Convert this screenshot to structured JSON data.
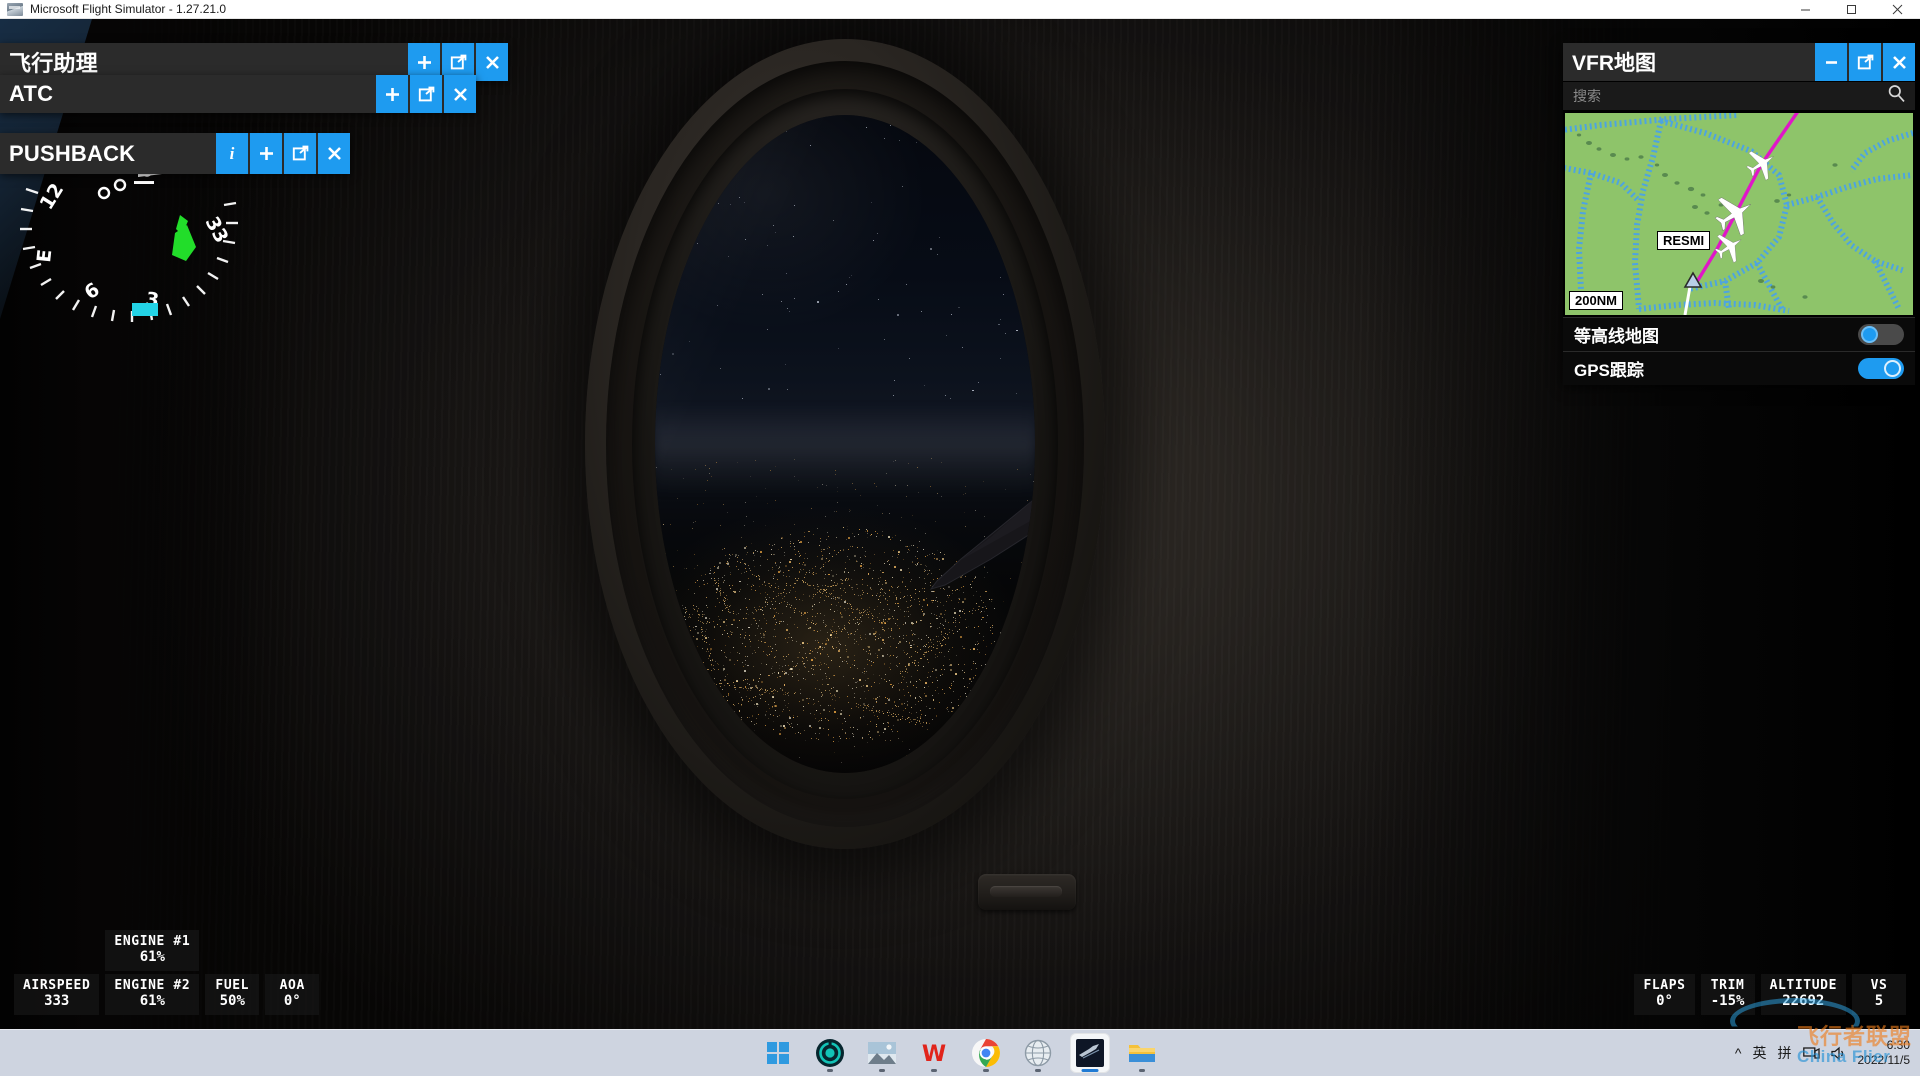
{
  "window": {
    "title": "Microsoft Flight Simulator - 1.27.21.0",
    "app_icon": "msfs-app-icon",
    "controls": {
      "minimize": "minimize-icon",
      "maximize": "maximize-icon",
      "close": "close-icon"
    }
  },
  "panels": [
    {
      "id": "assistant",
      "title": "飞行助理",
      "buttons": [
        {
          "name": "add-button",
          "glyph": "plus"
        },
        {
          "name": "popout-button",
          "glyph": "popout"
        },
        {
          "name": "close-button",
          "glyph": "close"
        }
      ]
    },
    {
      "id": "atc",
      "title": "ATC",
      "buttons": [
        {
          "name": "add-button",
          "glyph": "plus"
        },
        {
          "name": "popout-button",
          "glyph": "popout"
        },
        {
          "name": "close-button",
          "glyph": "close"
        }
      ]
    },
    {
      "id": "pushback",
      "title": "PUSHBACK",
      "buttons": [
        {
          "name": "info-button",
          "glyph": "info"
        },
        {
          "name": "add-button",
          "glyph": "plus"
        },
        {
          "name": "popout-button",
          "glyph": "popout"
        },
        {
          "name": "close-button",
          "glyph": "close"
        }
      ]
    }
  ],
  "vfr_map": {
    "title": "VFR地图",
    "window_buttons": {
      "minimize": "minimize-icon",
      "popout": "popout-icon",
      "close": "close-icon"
    },
    "search": {
      "placeholder": "搜索",
      "value": "",
      "icon": "search-icon"
    },
    "map": {
      "scale_label": "200NM",
      "waypoint_label": "RESMI",
      "terrain_color": "#8ec46a",
      "airspace_color": "#4aa3e8",
      "route_color": "#e016c8",
      "aircraft_count": 3
    },
    "options": [
      {
        "label": "等高线地图",
        "name": "contour-map-toggle",
        "state": "off"
      },
      {
        "label": "GPS跟踪",
        "name": "gps-tracking-toggle",
        "state": "on"
      }
    ]
  },
  "hud": {
    "left": [
      {
        "label": "AIRSPEED",
        "value": "333",
        "name": "airspeed-readout"
      },
      {
        "label": "ENGINE #1",
        "value": "61%",
        "name": "engine1-readout"
      },
      {
        "label": "ENGINE #2",
        "value": "61%",
        "name": "engine2-readout"
      },
      {
        "label": "FUEL",
        "value": "50%",
        "name": "fuel-readout"
      },
      {
        "label": "AOA",
        "value": "0°",
        "name": "aoa-readout"
      }
    ],
    "right": [
      {
        "label": "FLAPS",
        "value": "0°",
        "name": "flaps-readout"
      },
      {
        "label": "TRIM",
        "value": "-15%",
        "name": "trim-readout"
      },
      {
        "label": "ALTITUDE",
        "value": "22692",
        "name": "altitude-readout"
      },
      {
        "label": "VS",
        "value": "5",
        "name": "vs-readout"
      }
    ]
  },
  "compass": {
    "ticks": [
      "12",
      "E",
      "33",
      "3",
      "6"
    ],
    "heading_bug_color": "#22dd2a",
    "marker_color": "#23d3e6"
  },
  "taskbar": {
    "apps": [
      {
        "name": "start-button",
        "icon": "windows-logo-icon",
        "active": false
      },
      {
        "name": "taskbar-app-teal",
        "icon": "teal-circle-icon",
        "active": false
      },
      {
        "name": "taskbar-app-photos",
        "icon": "photo-icon",
        "active": false
      },
      {
        "name": "taskbar-app-wps",
        "icon": "wps-office-icon",
        "active": false
      },
      {
        "name": "taskbar-app-chrome",
        "icon": "chrome-icon",
        "active": false
      },
      {
        "name": "taskbar-app-globe",
        "icon": "globe-icon",
        "active": false
      },
      {
        "name": "taskbar-app-msfs",
        "icon": "msfs-icon",
        "active": true
      },
      {
        "name": "taskbar-app-explorer",
        "icon": "folder-icon",
        "active": false
      }
    ],
    "tray": {
      "overflow": "^",
      "ime_language": "英",
      "ime_mode": "拼",
      "network_icon": "network-icon",
      "volume_icon": "volume-icon",
      "time": "6:30",
      "date": "2022/11/5"
    }
  },
  "watermark": {
    "line1": "飞行者联盟",
    "line2": "China Flier"
  }
}
